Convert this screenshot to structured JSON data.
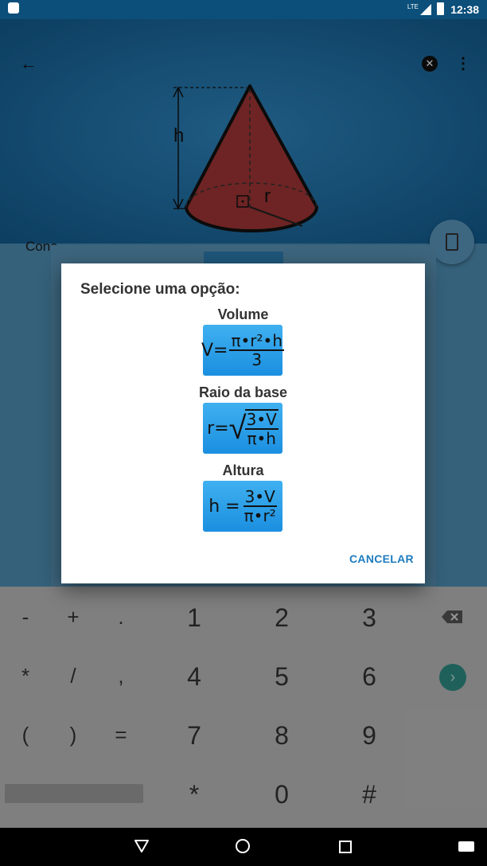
{
  "status_bar": {
    "time": "12:38",
    "network": "LTE"
  },
  "header": {
    "shape_name": "Cone",
    "height_label": "h",
    "radius_label": "r"
  },
  "dialog": {
    "title": "Selecione uma opção:",
    "options": [
      {
        "label": "Volume",
        "formula_lhs": "V=",
        "numerator": "π•r²•h",
        "denominator": "3"
      },
      {
        "label": "Raio da base",
        "formula_lhs": "r=",
        "numerator": "3•V",
        "denominator": "π•h"
      },
      {
        "label": "Altura",
        "formula_lhs": "h =",
        "numerator": "3•V",
        "denominator": "π•r²"
      }
    ],
    "cancel_label": "CANCELAR"
  },
  "keyboard": {
    "row1": [
      "-",
      "+",
      ".",
      "1",
      "2",
      "3"
    ],
    "row2": [
      "*",
      "/",
      ",",
      "4",
      "5",
      "6"
    ],
    "row3": [
      "(",
      ")",
      "=",
      "7",
      "8",
      "9"
    ],
    "row4": [
      "*",
      "0",
      "#"
    ]
  },
  "colors": {
    "accent": "#1e7cc0",
    "cone_fill": "#a33535",
    "formula_button": "#1b8fe0"
  }
}
